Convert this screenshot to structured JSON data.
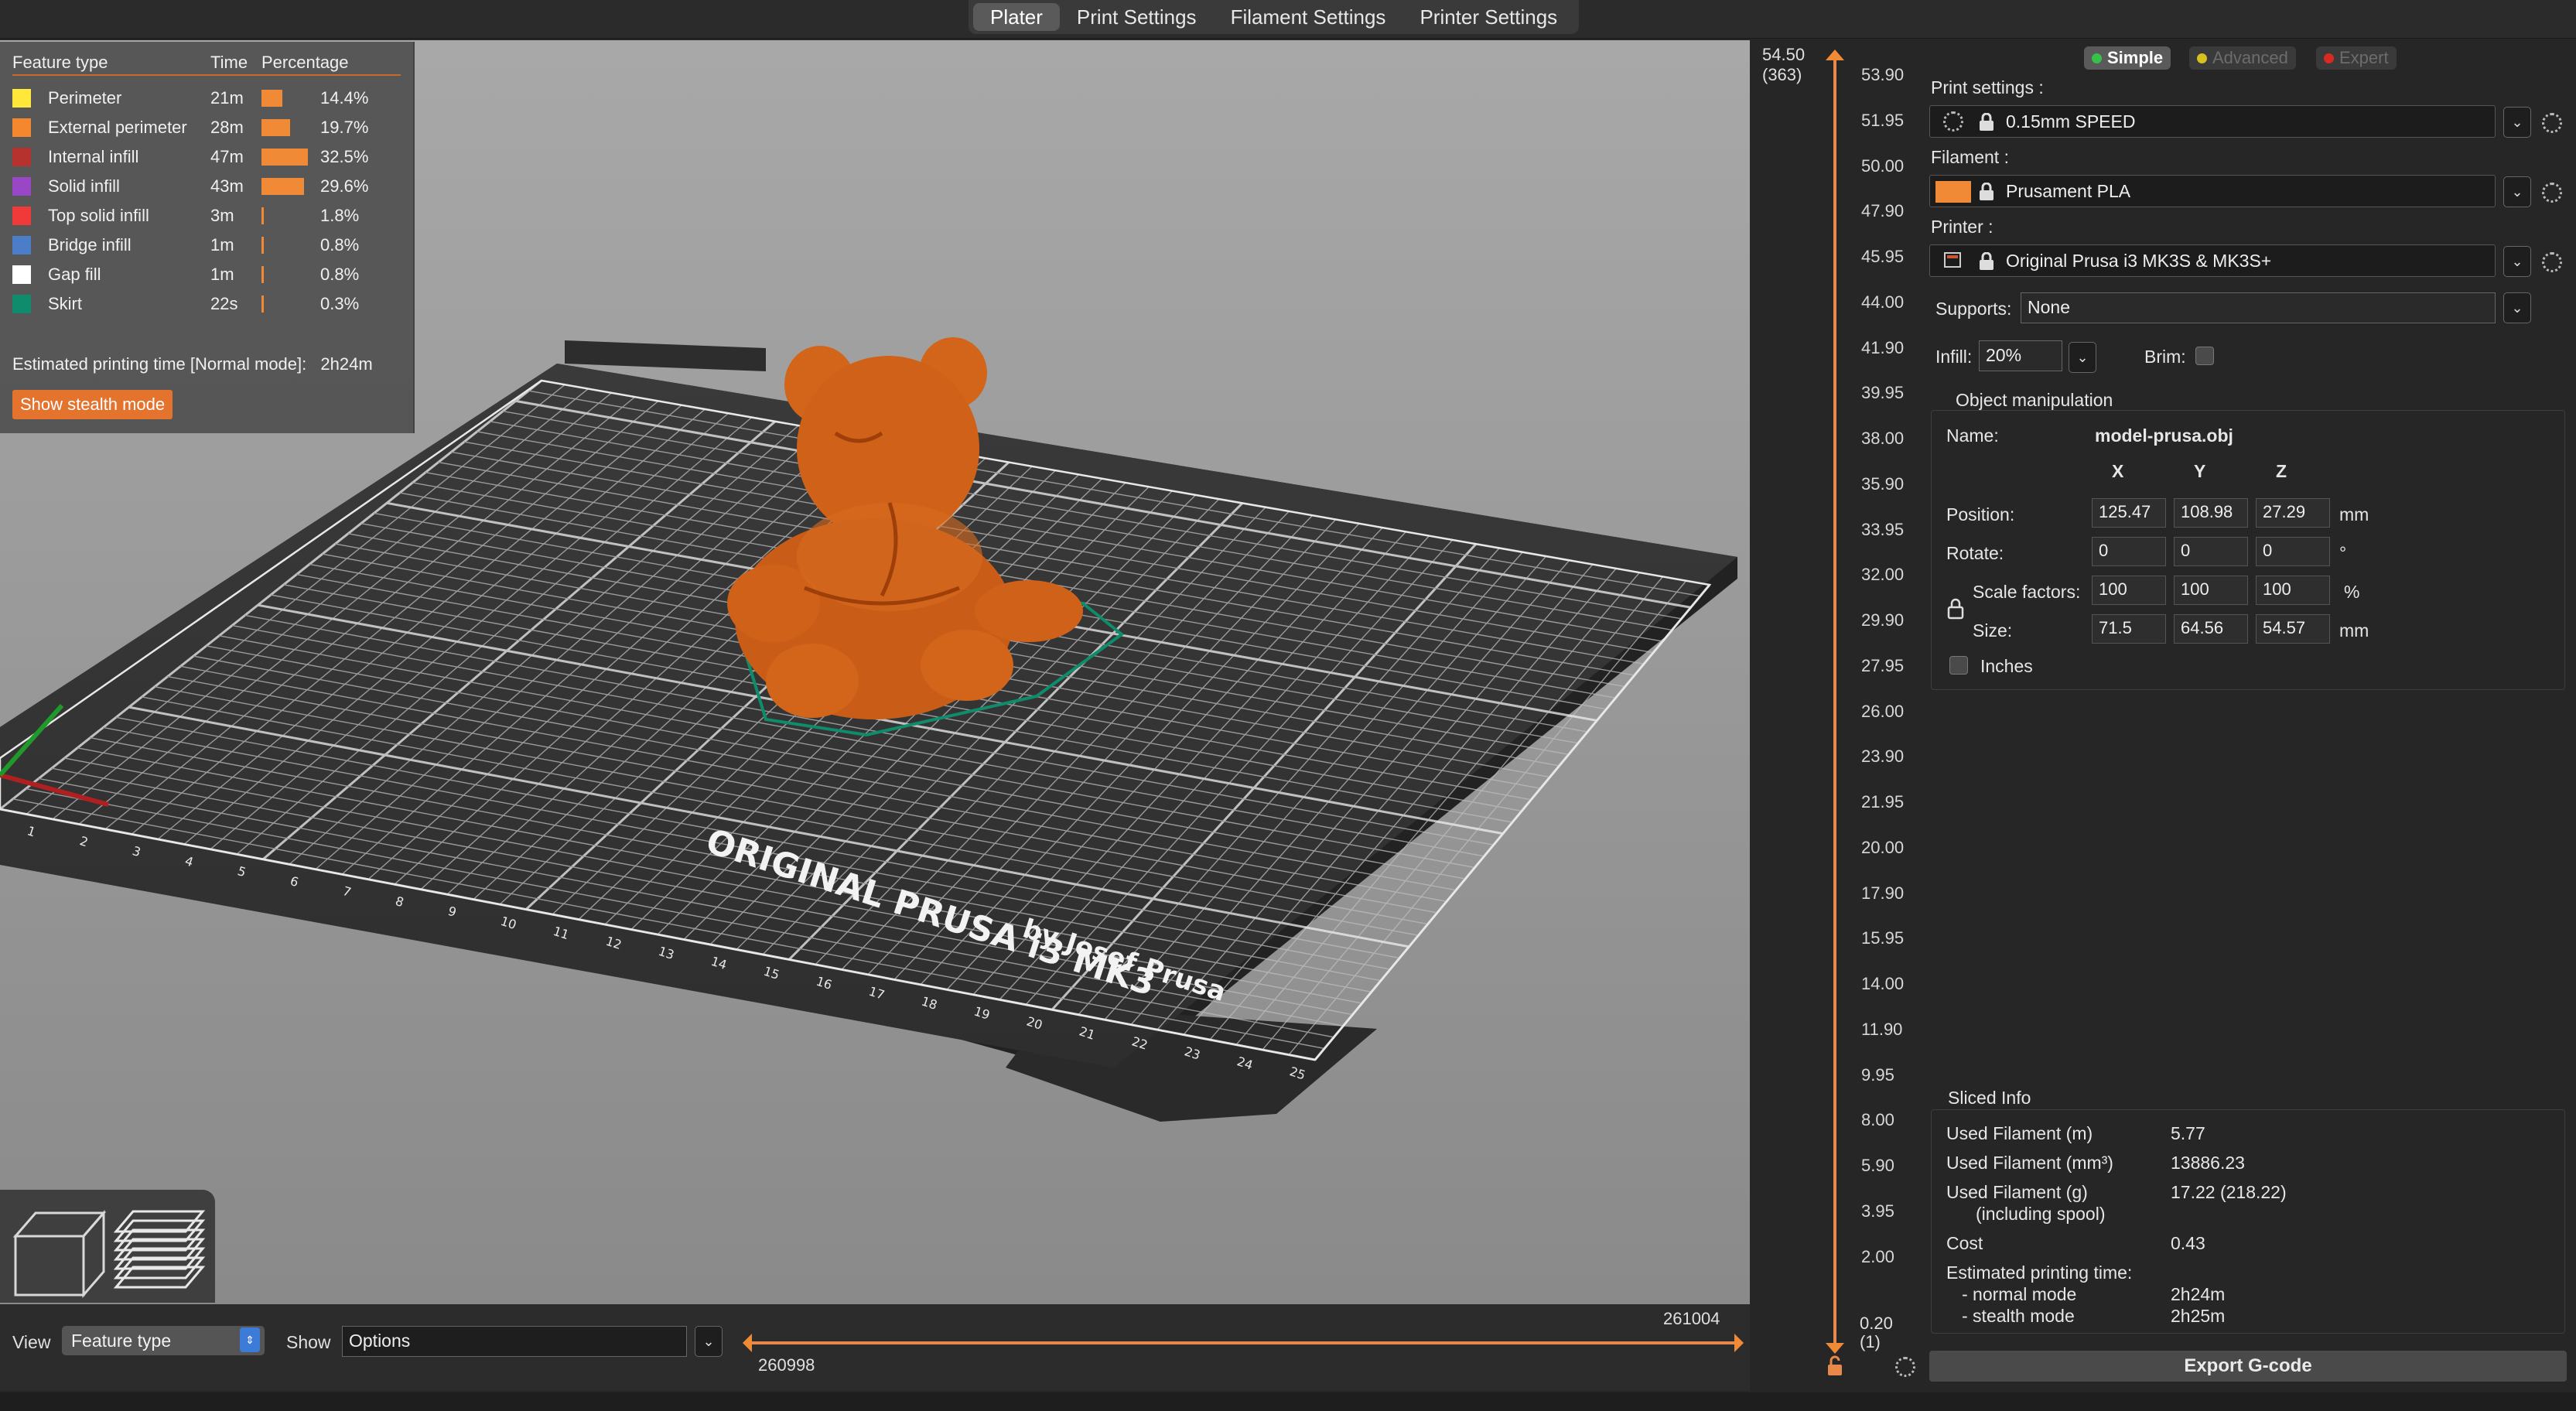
{
  "tabs": [
    "Plater",
    "Print Settings",
    "Filament Settings",
    "Printer Settings"
  ],
  "legend": {
    "headers": {
      "type": "Feature type",
      "time": "Time",
      "pct": "Percentage"
    },
    "rows": [
      {
        "name": "Perimeter",
        "time": "21m",
        "pct": "14.4%",
        "color": "#ffe83a",
        "fraction": 0.144
      },
      {
        "name": "External perimeter",
        "time": "28m",
        "pct": "19.7%",
        "color": "#f5872f",
        "fraction": 0.197
      },
      {
        "name": "Internal infill",
        "time": "47m",
        "pct": "32.5%",
        "color": "#b5322f",
        "fraction": 0.325
      },
      {
        "name": "Solid infill",
        "time": "43m",
        "pct": "29.6%",
        "color": "#9a47c7",
        "fraction": 0.296
      },
      {
        "name": "Top solid infill",
        "time": "3m",
        "pct": "1.8%",
        "color": "#f03a3a",
        "fraction": 0.018
      },
      {
        "name": "Bridge infill",
        "time": "1m",
        "pct": "0.8%",
        "color": "#4c7dc9",
        "fraction": 0.008
      },
      {
        "name": "Gap fill",
        "time": "1m",
        "pct": "0.8%",
        "color": "#ffffff",
        "fraction": 0.008
      },
      {
        "name": "Skirt",
        "time": "22s",
        "pct": "0.3%",
        "color": "#0e8c6b",
        "fraction": 0.003
      }
    ],
    "est_label": "Estimated printing time [Normal mode]:",
    "est_value": "2h24m",
    "stealth_button": "Show stealth mode"
  },
  "bed": {
    "title": "ORIGINAL PRUSA i3 MK3",
    "subtitle": "by Josef Prusa",
    "x_ticks": [
      "1",
      "2",
      "3",
      "4",
      "5",
      "6",
      "7",
      "8",
      "9",
      "10",
      "11",
      "12",
      "13",
      "14",
      "15",
      "16",
      "17",
      "18",
      "19",
      "20",
      "21",
      "22",
      "23",
      "24",
      "25"
    ]
  },
  "bottom": {
    "view_label": "View",
    "view_value": "Feature type",
    "show_label": "Show",
    "show_value": "Options",
    "hslider_left": "260998",
    "hslider_right": "261004"
  },
  "vslider": {
    "top_value": "54.50",
    "top_layer": "(363)",
    "bottom_value": "0.20",
    "bottom_layer": "(1)",
    "ticks": [
      "53.90",
      "51.95",
      "50.00",
      "47.90",
      "45.95",
      "44.00",
      "41.90",
      "39.95",
      "38.00",
      "35.90",
      "33.95",
      "32.00",
      "29.90",
      "27.95",
      "26.00",
      "23.90",
      "21.95",
      "20.00",
      "17.90",
      "15.95",
      "14.00",
      "11.90",
      "9.95",
      "8.00",
      "5.90",
      "3.95",
      "2.00"
    ]
  },
  "sidebar": {
    "modes": {
      "simple": "Simple",
      "advanced": "Advanced",
      "expert": "Expert"
    },
    "print_settings_label": "Print settings :",
    "print_settings_value": "0.15mm SPEED",
    "filament_label": "Filament :",
    "filament_value": "Prusament PLA",
    "filament_color": "#f08a36",
    "printer_label": "Printer :",
    "printer_value": "Original Prusa i3 MK3S & MK3S+",
    "supports_label": "Supports:",
    "supports_value": "None",
    "infill_label": "Infill:",
    "infill_value": "20%",
    "brim_label": "Brim:",
    "object_manipulation": {
      "title": "Object manipulation",
      "name_label": "Name:",
      "name_value": "model-prusa.obj",
      "axes": [
        "X",
        "Y",
        "Z"
      ],
      "position_label": "Position:",
      "position": [
        "125.47",
        "108.98",
        "27.29"
      ],
      "position_unit": "mm",
      "rotate_label": "Rotate:",
      "rotate": [
        "0",
        "0",
        "0"
      ],
      "rotate_unit": "°",
      "scale_label": "Scale factors:",
      "scale": [
        "100",
        "100",
        "100"
      ],
      "scale_unit": "%",
      "size_label": "Size:",
      "size": [
        "71.5",
        "64.56",
        "54.57"
      ],
      "size_unit": "mm",
      "inches_label": "Inches"
    },
    "sliced_info": {
      "title": "Sliced Info",
      "used_m_label": "Used Filament (m)",
      "used_m": "5.77",
      "used_mm3_label": "Used Filament (mm³)",
      "used_mm3": "13886.23",
      "used_g_label": "Used Filament (g)",
      "used_g_sub": "(including spool)",
      "used_g": "17.22 (218.22)",
      "cost_label": "Cost",
      "cost": "0.43",
      "est_label": "Estimated printing time:",
      "normal_label": "- normal mode",
      "normal": "2h24m",
      "stealth_label": "- stealth mode",
      "stealth": "2h25m"
    },
    "export_button": "Export G-code"
  }
}
